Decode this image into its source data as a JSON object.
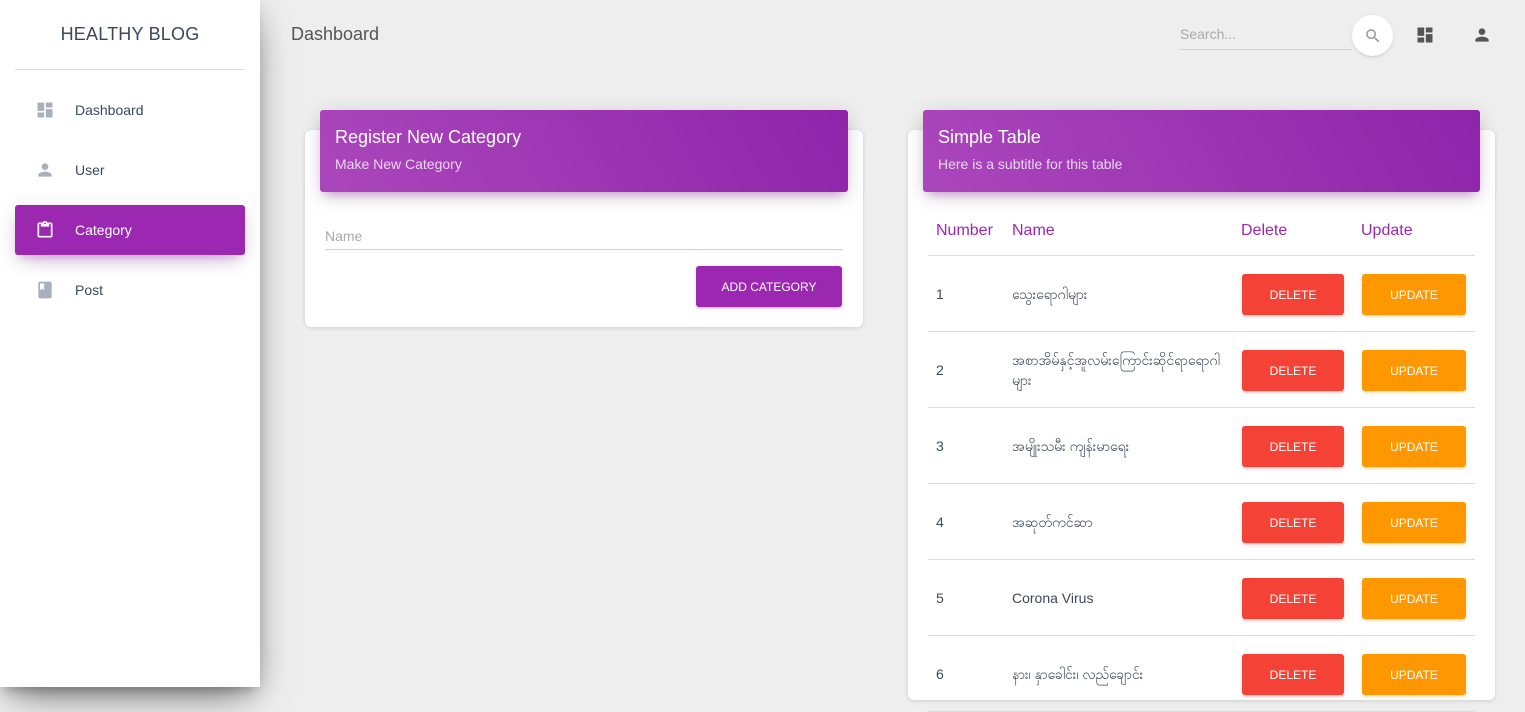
{
  "sidebar": {
    "brand": "HEALTHY BLOG",
    "items": [
      {
        "label": "Dashboard",
        "icon": "dashboard-icon",
        "active": false
      },
      {
        "label": "User",
        "icon": "person-icon",
        "active": false
      },
      {
        "label": "Category",
        "icon": "clipboard-icon",
        "active": true
      },
      {
        "label": "Post",
        "icon": "book-icon",
        "active": false
      }
    ]
  },
  "topbar": {
    "title": "Dashboard",
    "search_placeholder": "Search...",
    "icons": [
      "search-icon",
      "dashboard-icon",
      "person-icon"
    ]
  },
  "register_card": {
    "title": "Register New Category",
    "subtitle": "Make New Category",
    "name_placeholder": "Name",
    "submit_label": "ADD CATEGORY"
  },
  "table_card": {
    "title": "Simple Table",
    "subtitle": "Here is a subtitle for this table",
    "columns": [
      "Number",
      "Name",
      "Delete",
      "Update"
    ],
    "rows": [
      {
        "number": "1",
        "name": "သွေးရောဂါများ",
        "delete_label": "DELETE",
        "update_label": "UPDATE"
      },
      {
        "number": "2",
        "name": "အစာအိမ်နှင့်အူလမ်းကြောင်းဆိုင်ရာရောဂါများ",
        "delete_label": "DELETE",
        "update_label": "UPDATE"
      },
      {
        "number": "3",
        "name": "အမျိုးသမီး ကျန်းမာရေး",
        "delete_label": "DELETE",
        "update_label": "UPDATE"
      },
      {
        "number": "4",
        "name": "အဆုတ်ကင်ဆာ",
        "delete_label": "DELETE",
        "update_label": "UPDATE"
      },
      {
        "number": "5",
        "name": "Corona Virus",
        "delete_label": "DELETE",
        "update_label": "UPDATE"
      },
      {
        "number": "6",
        "name": "နား၊ နှာခေါင်း၊ လည်ချောင်း",
        "delete_label": "DELETE",
        "update_label": "UPDATE"
      }
    ]
  },
  "colors": {
    "primary": "#9c27b0",
    "danger": "#f44336",
    "warning": "#ff9800",
    "background": "#eeeeee"
  }
}
